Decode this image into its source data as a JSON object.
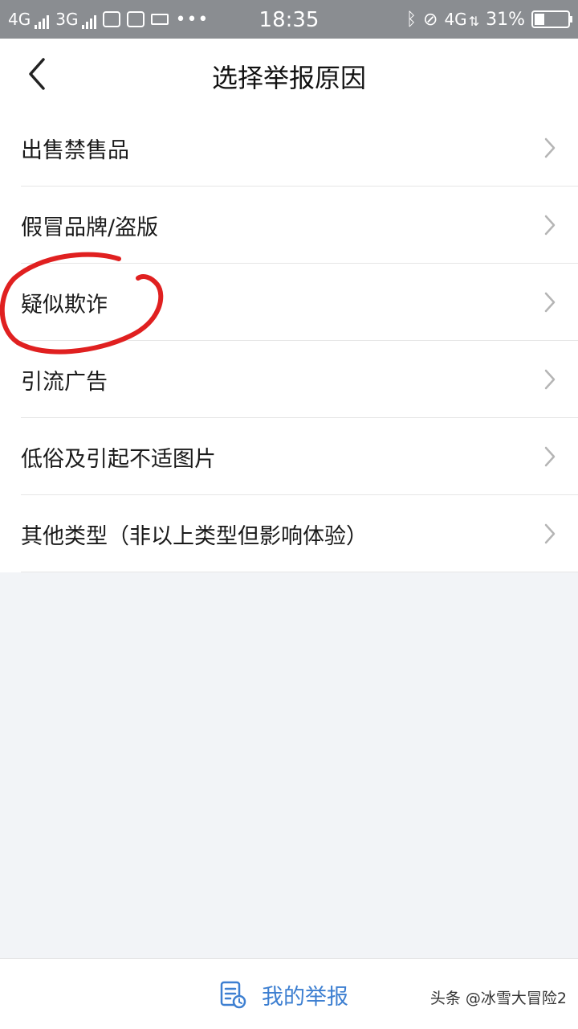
{
  "status_bar": {
    "net1": "4G",
    "net2": "3G",
    "time": "18:35",
    "net3": "4G",
    "battery": "31%",
    "battery_level": 0.31
  },
  "header": {
    "title": "选择举报原因",
    "back_icon": "chevron-left-icon"
  },
  "reasons": [
    {
      "label": "出售禁售品"
    },
    {
      "label": "假冒品牌/盗版"
    },
    {
      "label": "疑似欺诈"
    },
    {
      "label": "引流广告"
    },
    {
      "label": "低俗及引起不适图片"
    },
    {
      "label": "其他类型（非以上类型但影响体验）"
    }
  ],
  "bottom": {
    "my_report_label": "我的举报",
    "my_report_icon": "report-list-icon"
  },
  "watermark": "头条 @冰雪大冒险2",
  "colors": {
    "accent": "#3d7fd1",
    "annotation": "#e02020",
    "status_bar": "#8a8d91",
    "page_bg": "#f2f4f7"
  }
}
